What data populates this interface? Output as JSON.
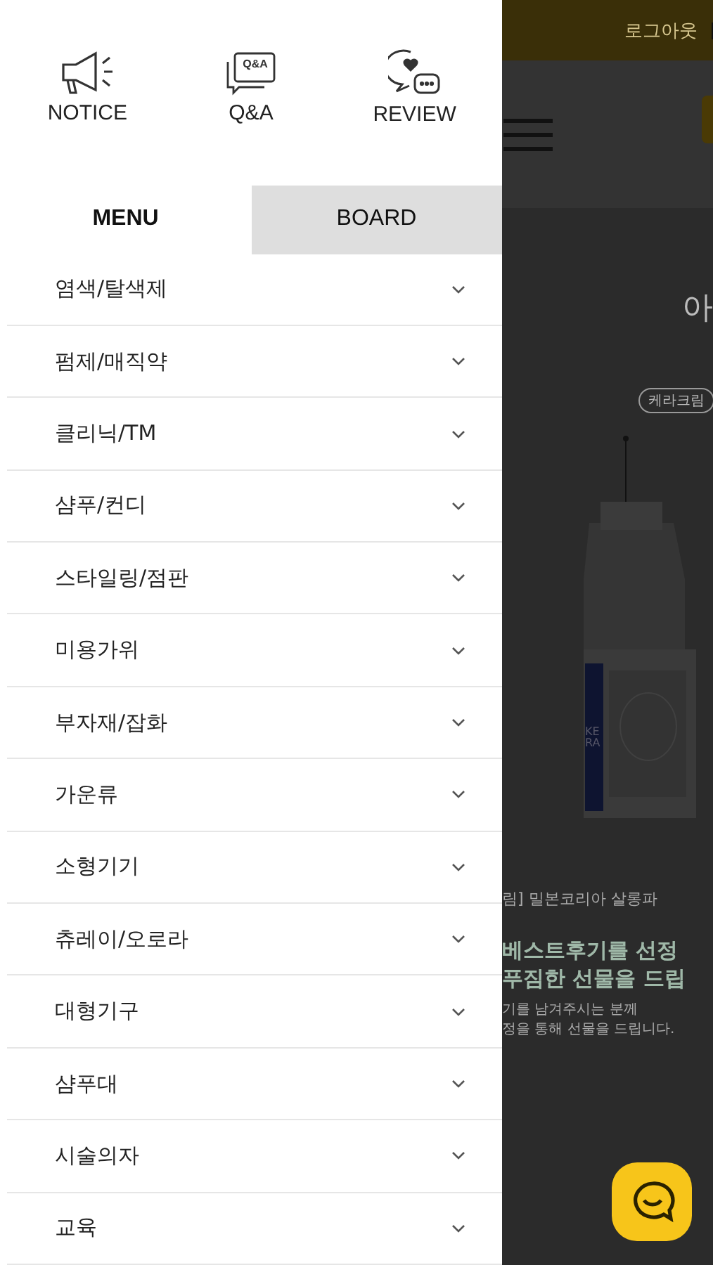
{
  "drawer": {
    "shortcuts": [
      {
        "kind": "notice",
        "label": "NOTICE"
      },
      {
        "kind": "qna",
        "label": "Q&A",
        "icon_text": "Q&A"
      },
      {
        "kind": "review",
        "label": "REVIEW"
      }
    ],
    "tabs": [
      {
        "label": "MENU",
        "selected": true
      },
      {
        "label": "BOARD",
        "selected": false
      }
    ],
    "menu": [
      {
        "label": "염색/탈색제",
        "expanded": false
      },
      {
        "label": "펌제/매직약",
        "expanded": false
      },
      {
        "label": "클리닉/TM",
        "expanded": false
      },
      {
        "label": "샴푸/컨디",
        "expanded": false
      },
      {
        "label": "스타일링/점판",
        "expanded": false
      },
      {
        "label": "미용가위",
        "expanded": false
      },
      {
        "label": "부자재/잡화",
        "expanded": false
      },
      {
        "label": "가운류",
        "expanded": false
      },
      {
        "label": "소형기기",
        "expanded": false
      },
      {
        "label": "츄레이/오로라",
        "expanded": false
      },
      {
        "label": "대형기구",
        "expanded": false
      },
      {
        "label": "샴푸대",
        "expanded": false
      },
      {
        "label": "시술의자",
        "expanded": false
      },
      {
        "label": "교육",
        "expanded": false
      }
    ]
  },
  "page": {
    "top_link": "로그아웃",
    "heading": "아",
    "product_tag": "케라크림",
    "product_label": "KERA",
    "event_title": "림] 밀본코리아 살롱파",
    "headline": [
      "베스트후기를 선정",
      "푸짐한 선물을 드립"
    ],
    "note": [
      "기를 남겨주시는 분께",
      "정을 통해 선물을 드립니다."
    ]
  }
}
